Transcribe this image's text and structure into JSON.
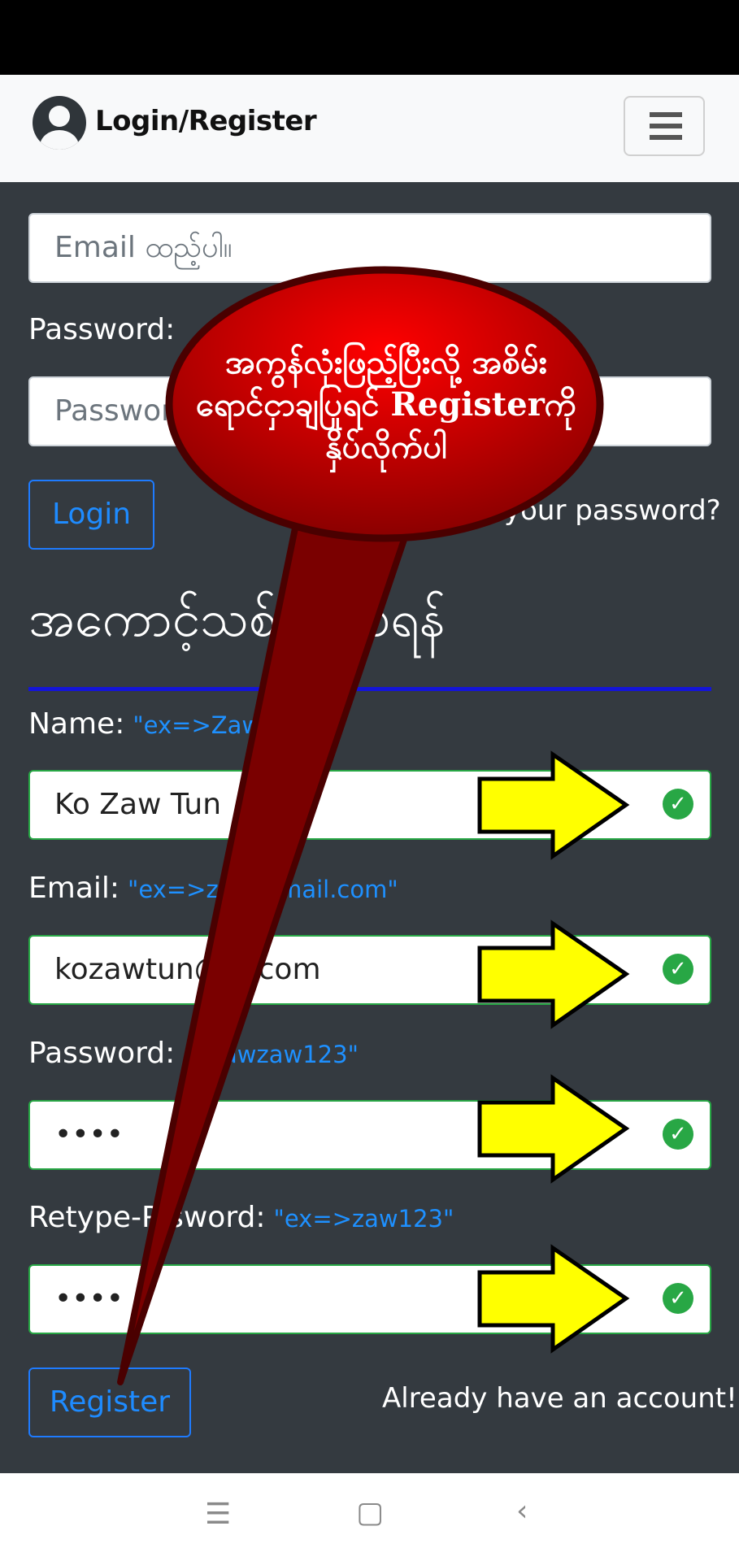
{
  "header": {
    "brand": "Login/Register"
  },
  "login": {
    "email_placeholder": "Email ထည့်ပါ။",
    "password_label": "Password:",
    "password_placeholder": "Password",
    "login_button": "Login",
    "forgot_link": "your password?"
  },
  "register": {
    "heading": "အကောင့်သစ်ပြုလုပ်ရန်",
    "name_label": "Name:",
    "name_hint": "\"ex=>Zaw",
    "name_value": "Ko Zaw Tun",
    "email_label": "Email:",
    "email_hint": "\"ex=>za  @gmail.com\"",
    "email_value": "kozawtun@  il.com",
    "password_label": "Password:",
    "password_hint": "  >zawzaw123\"",
    "password_value": "••••",
    "retype_label": "Retype-P  sword:",
    "retype_hint": "\"ex=>zaw123\"",
    "retype_value": "••••",
    "register_button": "Register",
    "already_link": "Already have an account!"
  },
  "annotation": {
    "callout_text": "အကွန်လုံးဖြည့်ပြီးလို့ အစိမ်းရောင်ငှာချပြုရင် Registerကိုနှိပ်လိုက်ပါ",
    "callout_color": "#cc0000",
    "arrow_color": "#ffff00"
  },
  "icons": {
    "valid": "check-circle-icon"
  }
}
